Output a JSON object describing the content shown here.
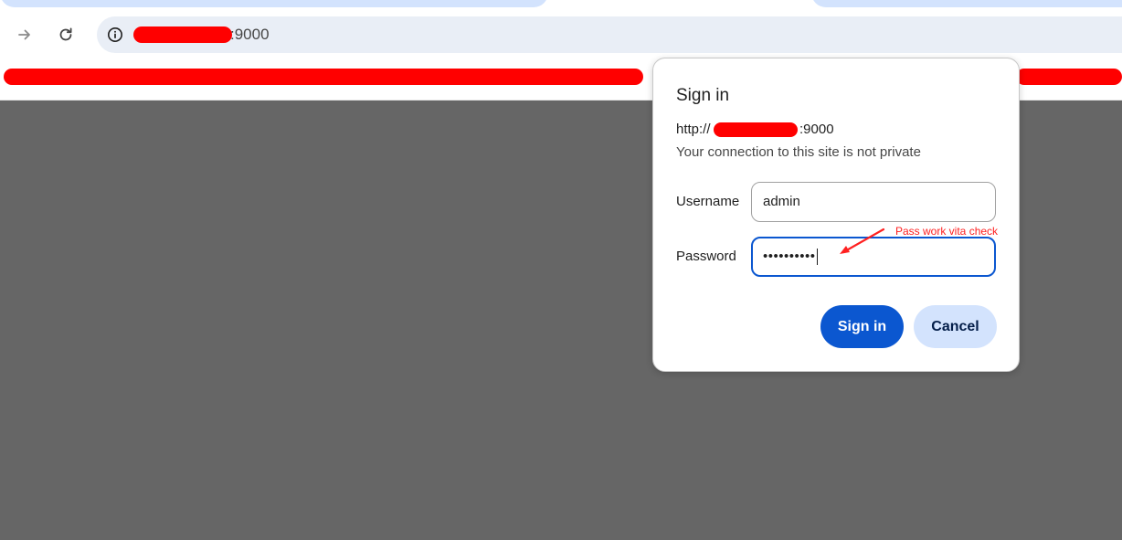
{
  "browser": {
    "url_suffix": ":9000",
    "icons": {
      "forward": "arrow-forward-icon",
      "reload": "reload-icon",
      "site_info": "info-circle-icon"
    }
  },
  "dialog": {
    "title": "Sign in",
    "origin_prefix": "http://",
    "origin_port": ":9000",
    "warning": "Your connection to this site is not private",
    "username_label": "Username",
    "username_value": "admin",
    "password_label": "Password",
    "password_mask": "••••••••••",
    "signin_label": "Sign in",
    "cancel_label": "Cancel"
  },
  "annotation": {
    "text": "Pass work vita check",
    "color": "#ff2020"
  },
  "colors": {
    "accent": "#0b57d0",
    "redaction": "#ff0000",
    "page_background": "#666666"
  }
}
